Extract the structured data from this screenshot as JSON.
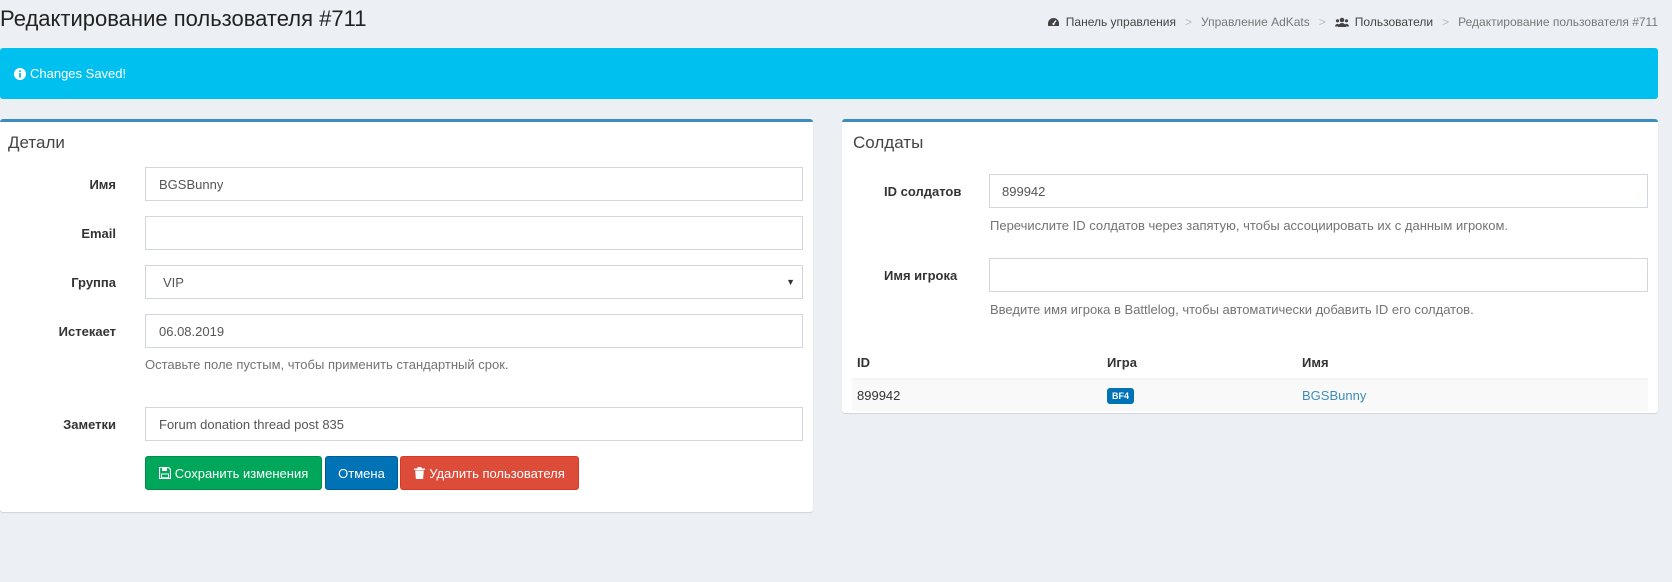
{
  "header": {
    "title": "Редактирование пользователя #711",
    "breadcrumb": [
      {
        "label": "Панель управления",
        "icon": "dashboard-icon"
      },
      {
        "label": "Управление AdKats",
        "icon": ""
      },
      {
        "label": "Пользователи",
        "icon": "users-icon"
      },
      {
        "label": "Редактирование пользователя #711",
        "icon": ""
      }
    ],
    "separator": ">"
  },
  "alert": {
    "text": "Changes Saved!",
    "icon": "info-circle-icon",
    "color": "#00c0ef"
  },
  "details": {
    "title": "Детали",
    "fields": {
      "name": {
        "label": "Имя",
        "value": "BGSBunny"
      },
      "email": {
        "label": "Email",
        "value": ""
      },
      "group": {
        "label": "Группа",
        "value": "VIP"
      },
      "expires": {
        "label": "Истекает",
        "value": "06.08.2019",
        "help": "Оставьте поле пустым, чтобы применить стандартный срок."
      },
      "notes": {
        "label": "Заметки",
        "value": "Forum donation thread  post 835"
      }
    },
    "buttons": {
      "save": {
        "label": "Сохранить изменения",
        "icon": "save-icon",
        "color": "#00a65a"
      },
      "cancel": {
        "label": "Отмена",
        "color": "#0073b7"
      },
      "delete": {
        "label": "Удалить пользователя",
        "icon": "trash-icon",
        "color": "#dd4b39"
      }
    }
  },
  "soldiers": {
    "title": "Солдаты",
    "ids": {
      "label": "ID солдатов",
      "value": "899942",
      "help": "Перечислите ID солдатов через запятую, чтобы ассоциировать их с данным игроком."
    },
    "player": {
      "label": "Имя игрока",
      "value": "",
      "help": "Введите имя игрока в Battlelog, чтобы автоматически добавить ID его солдатов."
    },
    "table": {
      "columns": [
        "ID",
        "Игра",
        "Имя"
      ],
      "rows": [
        {
          "id": "899942",
          "game": "BF4",
          "name": "BGSBunny"
        }
      ]
    }
  }
}
